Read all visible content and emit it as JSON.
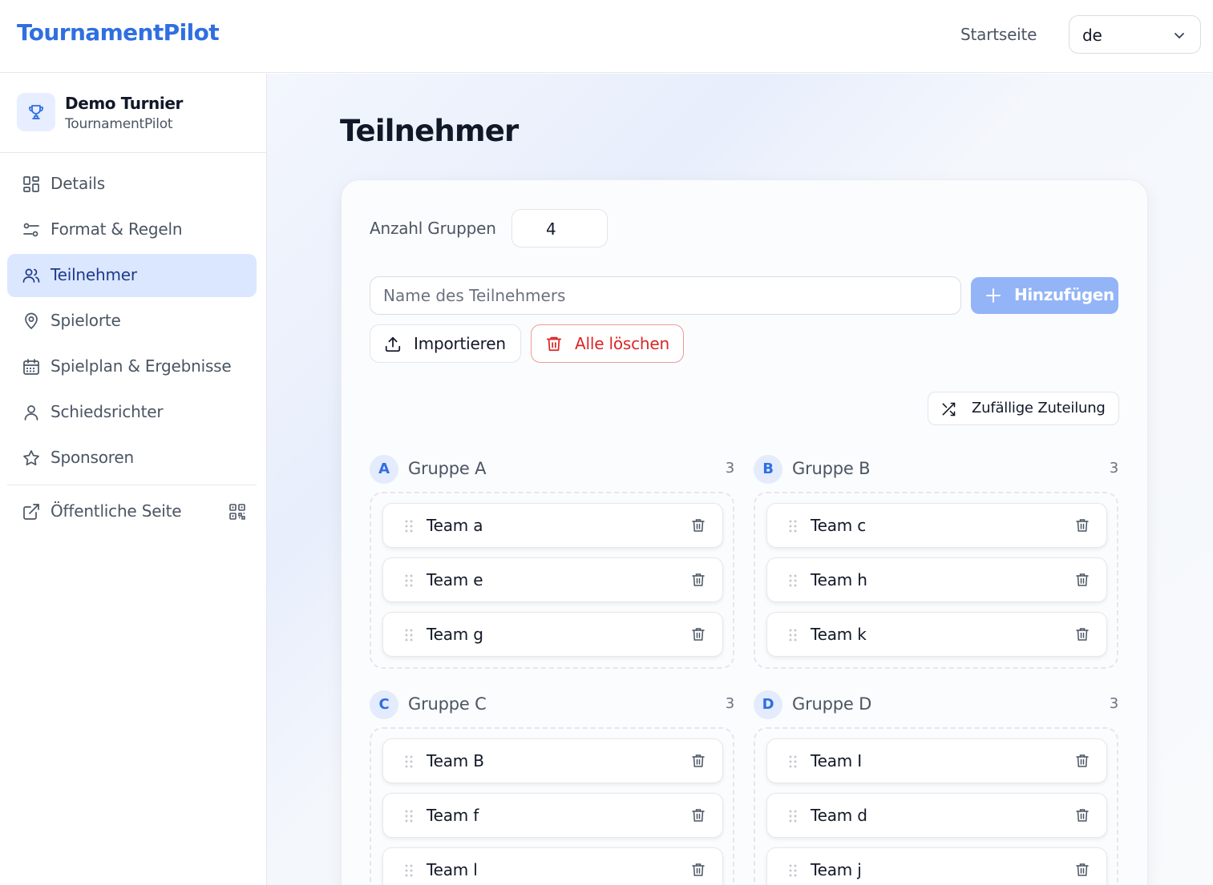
{
  "header": {
    "brand": "TournamentPilot",
    "home_link": "Startseite",
    "language": "de"
  },
  "tournament": {
    "name": "Demo Turnier",
    "subtitle": "TournamentPilot"
  },
  "nav": {
    "items": [
      {
        "label": "Details",
        "icon": "grid-icon"
      },
      {
        "label": "Format & Regeln",
        "icon": "sliders-icon"
      },
      {
        "label": "Teilnehmer",
        "icon": "users-icon",
        "active": true
      },
      {
        "label": "Spielorte",
        "icon": "map-pin-icon"
      },
      {
        "label": "Spielplan & Ergebnisse",
        "icon": "calendar-icon"
      },
      {
        "label": "Schiedsrichter",
        "icon": "user-icon"
      },
      {
        "label": "Sponsoren",
        "icon": "star-icon"
      }
    ],
    "public_page": {
      "label": "Öffentliche Seite",
      "icon": "external-link-icon",
      "extra_icon": "qr-code-icon"
    }
  },
  "main": {
    "title": "Teilnehmer",
    "group_count_label": "Anzahl Gruppen",
    "group_count": "4",
    "name_placeholder": "Name des Teilnehmers",
    "add_label": "Hinzufügen",
    "import_label": "Importieren",
    "clear_all_label": "Alle löschen",
    "random_assign_label": "Zufällige Zuteilung"
  },
  "groups": [
    {
      "letter": "A",
      "name": "Gruppe A",
      "count": "3",
      "teams": [
        "Team a",
        "Team e",
        "Team g"
      ]
    },
    {
      "letter": "B",
      "name": "Gruppe B",
      "count": "3",
      "teams": [
        "Team c",
        "Team h",
        "Team k"
      ]
    },
    {
      "letter": "C",
      "name": "Gruppe C",
      "count": "3",
      "teams": [
        "Team B",
        "Team f",
        "Team l"
      ]
    },
    {
      "letter": "D",
      "name": "Gruppe D",
      "count": "3",
      "teams": [
        "Team I",
        "Team d",
        "Team j"
      ]
    }
  ],
  "colors": {
    "accent": "#2f6fe0",
    "active_nav_bg": "#dbe7fe",
    "add_button": "#93b4f7",
    "danger": "#dc2626"
  }
}
